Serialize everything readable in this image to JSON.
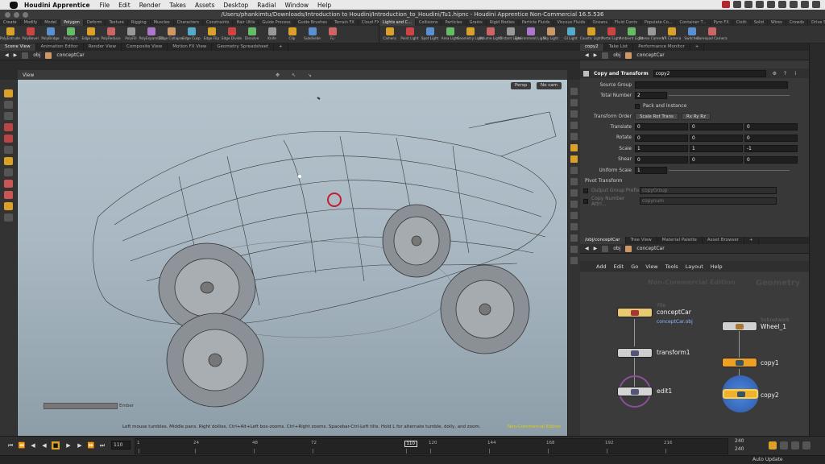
{
  "menubar": {
    "app": "Houdini Apprentice",
    "items": [
      "File",
      "Edit",
      "Render",
      "Takes",
      "Assets",
      "Desktop",
      "Radial",
      "Window",
      "Help"
    ]
  },
  "window": {
    "title": "/Users/phankimtu/Downloads/Introduction to Houdini/Introduction_to_Houdini/Tu1.hipnc - Houdini Apprentice Non-Commercial 16.5.536"
  },
  "shelf_left": {
    "tabs": [
      "Create",
      "Modify",
      "Model",
      "Polygon",
      "Deform",
      "Texture",
      "Rigging",
      "Muscles",
      "Characters",
      "Constraints",
      "Hair Utils",
      "Guide Process",
      "Guide Brushes",
      "Terrain FX",
      "Cloud FX",
      "Volume",
      "+"
    ],
    "tools": [
      "PolyExtrude",
      "PolyBevel",
      "PolyBridge",
      "PolySplit",
      "Edge Loop",
      "PolyReduce",
      "PolyFill",
      "PolyExpand2D",
      "Edge Collapse",
      "Edge Cusp",
      "Edge Flip",
      "Edge Divide",
      "Dissolve",
      "Knife",
      "Clip",
      "Subdivide",
      "Fu"
    ]
  },
  "shelf_right": {
    "tabs": [
      "Lights and C...",
      "Collisions",
      "Particles",
      "Grains",
      "Rigid Bodies",
      "Particle Fluids",
      "Viscous Fluids",
      "Oceans",
      "Fluid Conts",
      "Populate Co...",
      "Container T...",
      "Pyro FX",
      "Cloth",
      "Solid",
      "Wires",
      "Crowds",
      "Drive Simul..."
    ],
    "tools": [
      "Camera",
      "Point Light",
      "Spot Light",
      "Area Light",
      "Geometry Light",
      "Volume Light",
      "Distant Light",
      "Environment Light",
      "Sky Light",
      "GI Light",
      "Caustic Light",
      "Portal Light",
      "Ambient Light",
      "Stereo Camera",
      "VR Camera",
      "Switcher",
      "Gamepad Camera"
    ]
  },
  "viewer": {
    "tabs": [
      "Scene View",
      "Animation Editor",
      "Render View",
      "Composite View",
      "Motion FX View",
      "Geometry Spreadsheet",
      "+"
    ],
    "path": [
      "obj",
      "conceptCar"
    ],
    "label": "View",
    "persp": "Persp",
    "cam": "No cam",
    "status": "Left mouse tumbles. Middle pans. Right dollies. Ctrl+Alt+Left box-zooms. Ctrl+Right zooms. Spacebar-Ctrl-Left tilts. Hold L for alternate tumble, dolly, and zoom.",
    "nce": "Non-Commercial Edition",
    "slider_label": "Ember"
  },
  "params": {
    "tabs": [
      "copy2",
      "Take List",
      "Performance Monitor",
      "+"
    ],
    "path": [
      "obj",
      "conceptCar"
    ],
    "node_type": "Copy and Transform",
    "node_name": "copy2",
    "source_group_label": "Source Group",
    "total_number_label": "Total Number",
    "total_number": "2",
    "pack_label": "Pack and Instance",
    "order_label": "Transform Order",
    "order_value": "Scale Rot Trans",
    "rot_order": "Rx Ry Rz",
    "rows": [
      {
        "label": "Translate",
        "v": [
          "0",
          "0",
          "0"
        ]
      },
      {
        "label": "Rotate",
        "v": [
          "0",
          "0",
          "0"
        ]
      },
      {
        "label": "Scale",
        "v": [
          "1",
          "1",
          "-1"
        ]
      },
      {
        "label": "Shear",
        "v": [
          "0",
          "0",
          "0"
        ]
      }
    ],
    "uniform_label": "Uniform Scale",
    "uniform_value": "1",
    "pivot_label": "Pivot Transform",
    "out_group_label": "Output Group Prefix",
    "out_group_value": "copyGroup",
    "copy_attr_label": "Copy Number Attri...",
    "copy_attr_value": "copynum"
  },
  "network": {
    "tabs": [
      "/obj/conceptCar",
      "Tree View",
      "Material Palette",
      "Asset Browser",
      "+"
    ],
    "path": [
      "obj",
      "conceptCar"
    ],
    "menu": [
      "Add",
      "Edit",
      "Go",
      "View",
      "Tools",
      "Layout",
      "Help"
    ],
    "watermark_nce": "Non-Commercial Edition",
    "watermark_ctx": "Geometry",
    "nodes": {
      "file": {
        "type": "File",
        "name": "conceptCar",
        "sub": "conceptCar.obj"
      },
      "transform": {
        "name": "transform1"
      },
      "edit": {
        "name": "edit1"
      },
      "wheel": {
        "type": "Subnetwork",
        "name": "Wheel_1"
      },
      "copy1": {
        "name": "copy1"
      },
      "copy2": {
        "name": "copy2"
      }
    }
  },
  "timeline": {
    "current_frame": "110",
    "start": "1",
    "end": "240",
    "end2": "240",
    "ticks": [
      "1",
      "24",
      "48",
      "72",
      "110",
      "120",
      "144",
      "168",
      "192",
      "216"
    ],
    "auto_update": "Auto Update"
  },
  "colors": {
    "accent": "#f0a020",
    "file_node": "#e8c870",
    "selected_node": "#f0b030",
    "node_gray": "#cfcfcf",
    "viewport_top": "#b4c3cc",
    "nce_yellow": "#e0d000"
  }
}
